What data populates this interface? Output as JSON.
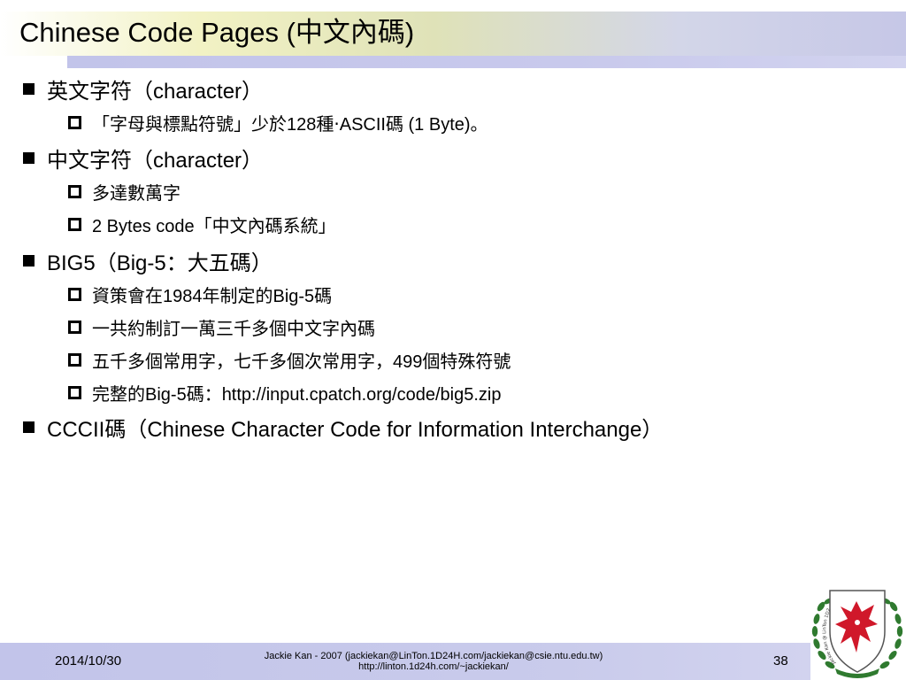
{
  "slide": {
    "title": "Chinese Code Pages (中文內碼)"
  },
  "bullets": [
    {
      "text": "英文字符（character）"
    },
    {
      "text": "「字母與標點符號」少於128種‧ASCII碼 (1 Byte)。"
    },
    {
      "text": "中文字符（character）"
    },
    {
      "text": "多達數萬字"
    },
    {
      "text": "2 Bytes code「中文內碼系統」"
    },
    {
      "text": "BIG5（Big-5：大五碼）"
    },
    {
      "text": "資策會在1984年制定的Big-5碼"
    },
    {
      "text": "一共約制訂一萬三千多個中文字內碼"
    },
    {
      "text": "五千多個常用字，七千多個次常用字，499個特殊符號"
    },
    {
      "text": "完整的Big-5碼：http://input.cpatch.org/code/big5.zip"
    },
    {
      "text": "CCCII碼（Chinese Character Code for Information Interchange）"
    }
  ],
  "footer": {
    "date": "2014/10/30",
    "credit_line1": "Jackie Kan - 2007 (jackiekan@LinTon.1D24H.com/jackiekan@csie.ntu.edu.tw)",
    "credit_line2": "http://linton.1d24h.com/~jackiekan/",
    "page_number": "38"
  },
  "colors": {
    "title_band_start": "#ffffff",
    "title_band_mid": "#f2f2c4",
    "title_band_end": "#c6c7e7",
    "footer_band": "#c2c4ea",
    "emblem_wreath": "#2f7a2f",
    "emblem_dragon": "#d0182a"
  },
  "emblem": {
    "icon": "school-crest-icon",
    "text": "Jackie Kan @ LinTon 1D24H.COM"
  }
}
